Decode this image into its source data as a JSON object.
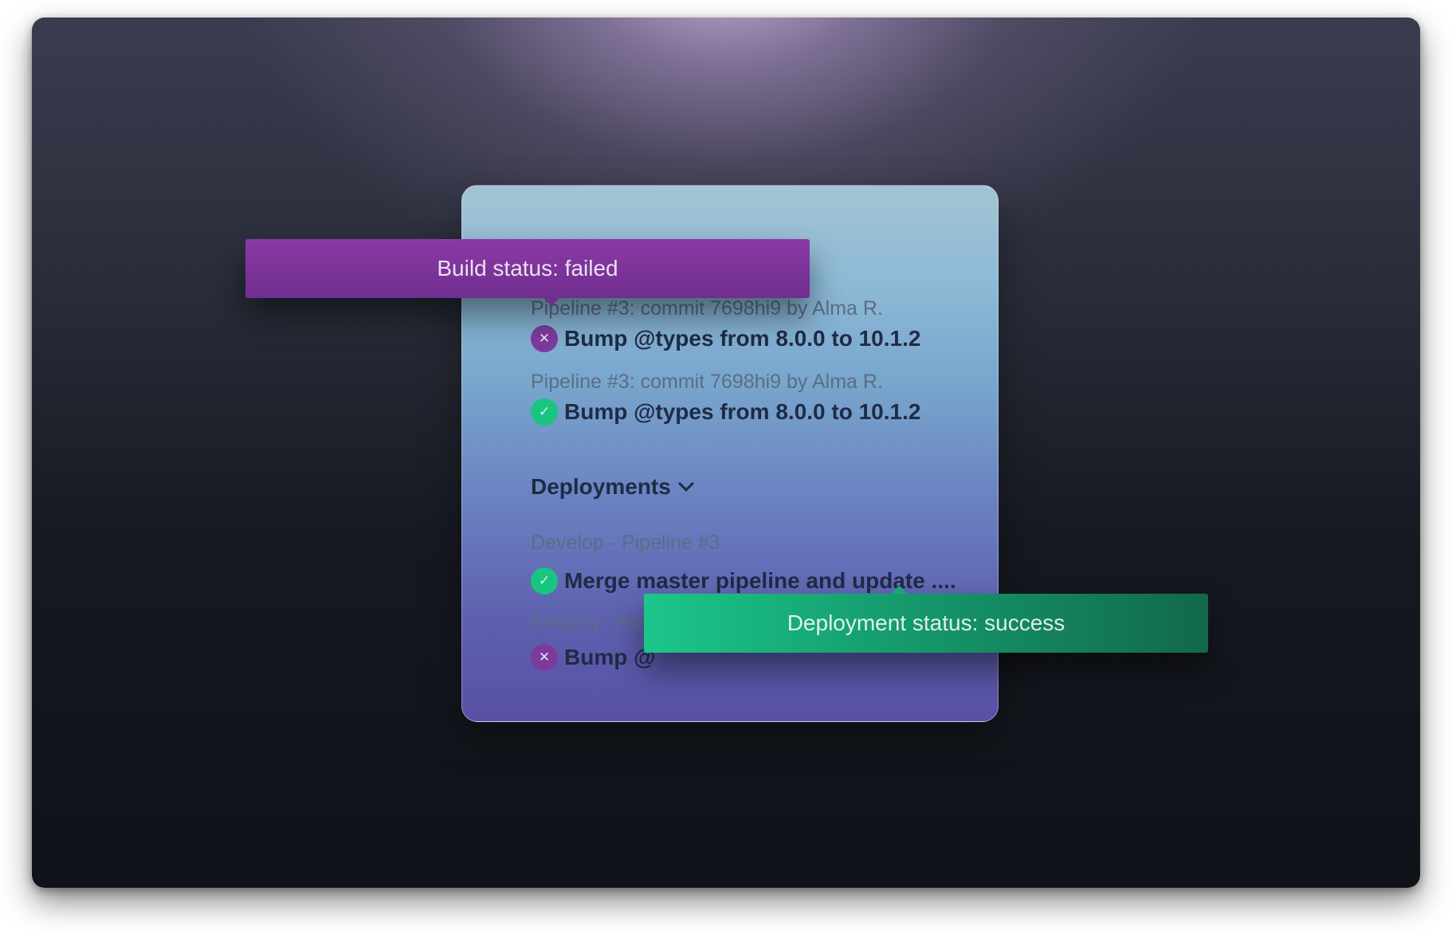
{
  "tooltips": {
    "build": "Build status: failed",
    "deployment": "Deployment status: success"
  },
  "pipelines": [
    {
      "meta": "Pipeline #3: commit  7698hi9 by Alma R.",
      "title": "Bump @types from 8.0.0 to 10.1.2",
      "status": "failed",
      "icon": "x-icon"
    },
    {
      "meta": "Pipeline #3: commit  7698hi9 by Alma R.",
      "title": "Bump @types from 8.0.0 to 10.1.2",
      "status": "success",
      "icon": "check-icon"
    }
  ],
  "deployments": {
    "header": "Deployments",
    "items": [
      {
        "meta": "Develop - Pipeline #3",
        "title": "Merge master pipeline and update ....",
        "status": "success",
        "icon": "check-icon"
      },
      {
        "meta": "Staging - Pip",
        "title": "Bump @",
        "status": "failed",
        "icon": "x-icon"
      }
    ]
  },
  "colors": {
    "failed": "#7d3a9e",
    "success": "#19c57f"
  }
}
